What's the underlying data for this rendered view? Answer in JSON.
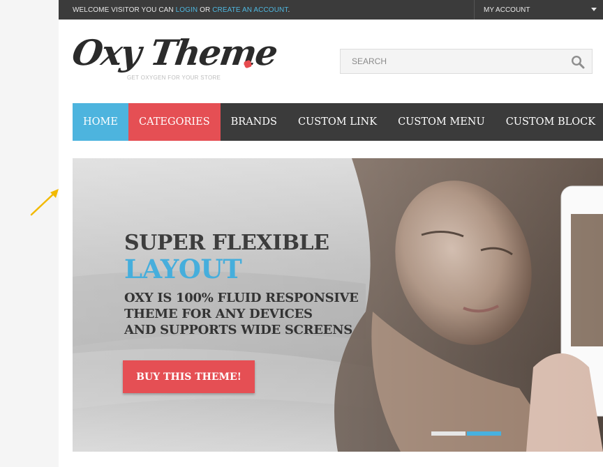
{
  "topbar": {
    "welcome_prefix": "WELCOME VISITOR YOU CAN",
    "login_label": "LOGIN",
    "or_text": "OR",
    "create_account_label": "CREATE AN ACCOUNT",
    "period": ".",
    "account_label": "MY ACCOUNT"
  },
  "logo": {
    "name": "Oxy Theme",
    "tagline": "GET OXYGEN FOR YOUR STORE",
    "accent_color": "#e84c50"
  },
  "search": {
    "placeholder": "SEARCH",
    "icon": "search-icon"
  },
  "nav": {
    "items": [
      {
        "label": "HOME",
        "color": "#4db4de"
      },
      {
        "label": "CATEGORIES",
        "color": "#e54f54"
      },
      {
        "label": "BRANDS"
      },
      {
        "label": "CUSTOM LINK"
      },
      {
        "label": "CUSTOM MENU"
      },
      {
        "label": "CUSTOM BLOCK"
      }
    ]
  },
  "slider": {
    "headline_1": "SUPER FLEXIBLE",
    "headline_2": "LAYOUT",
    "body_lines": [
      "OXY IS 100% FLUID RESPONSIVE",
      "THEME FOR ANY DEVICES",
      "AND SUPPORTS WIDE SCREENS"
    ],
    "button_label": "BUY THIS THEME!",
    "slide_count": 2,
    "active_slide": 2
  },
  "colors": {
    "topbar": "#3b3b3b",
    "nav": "#3b3b3b",
    "accent_blue": "#4db4de",
    "accent_red": "#e54f54"
  }
}
